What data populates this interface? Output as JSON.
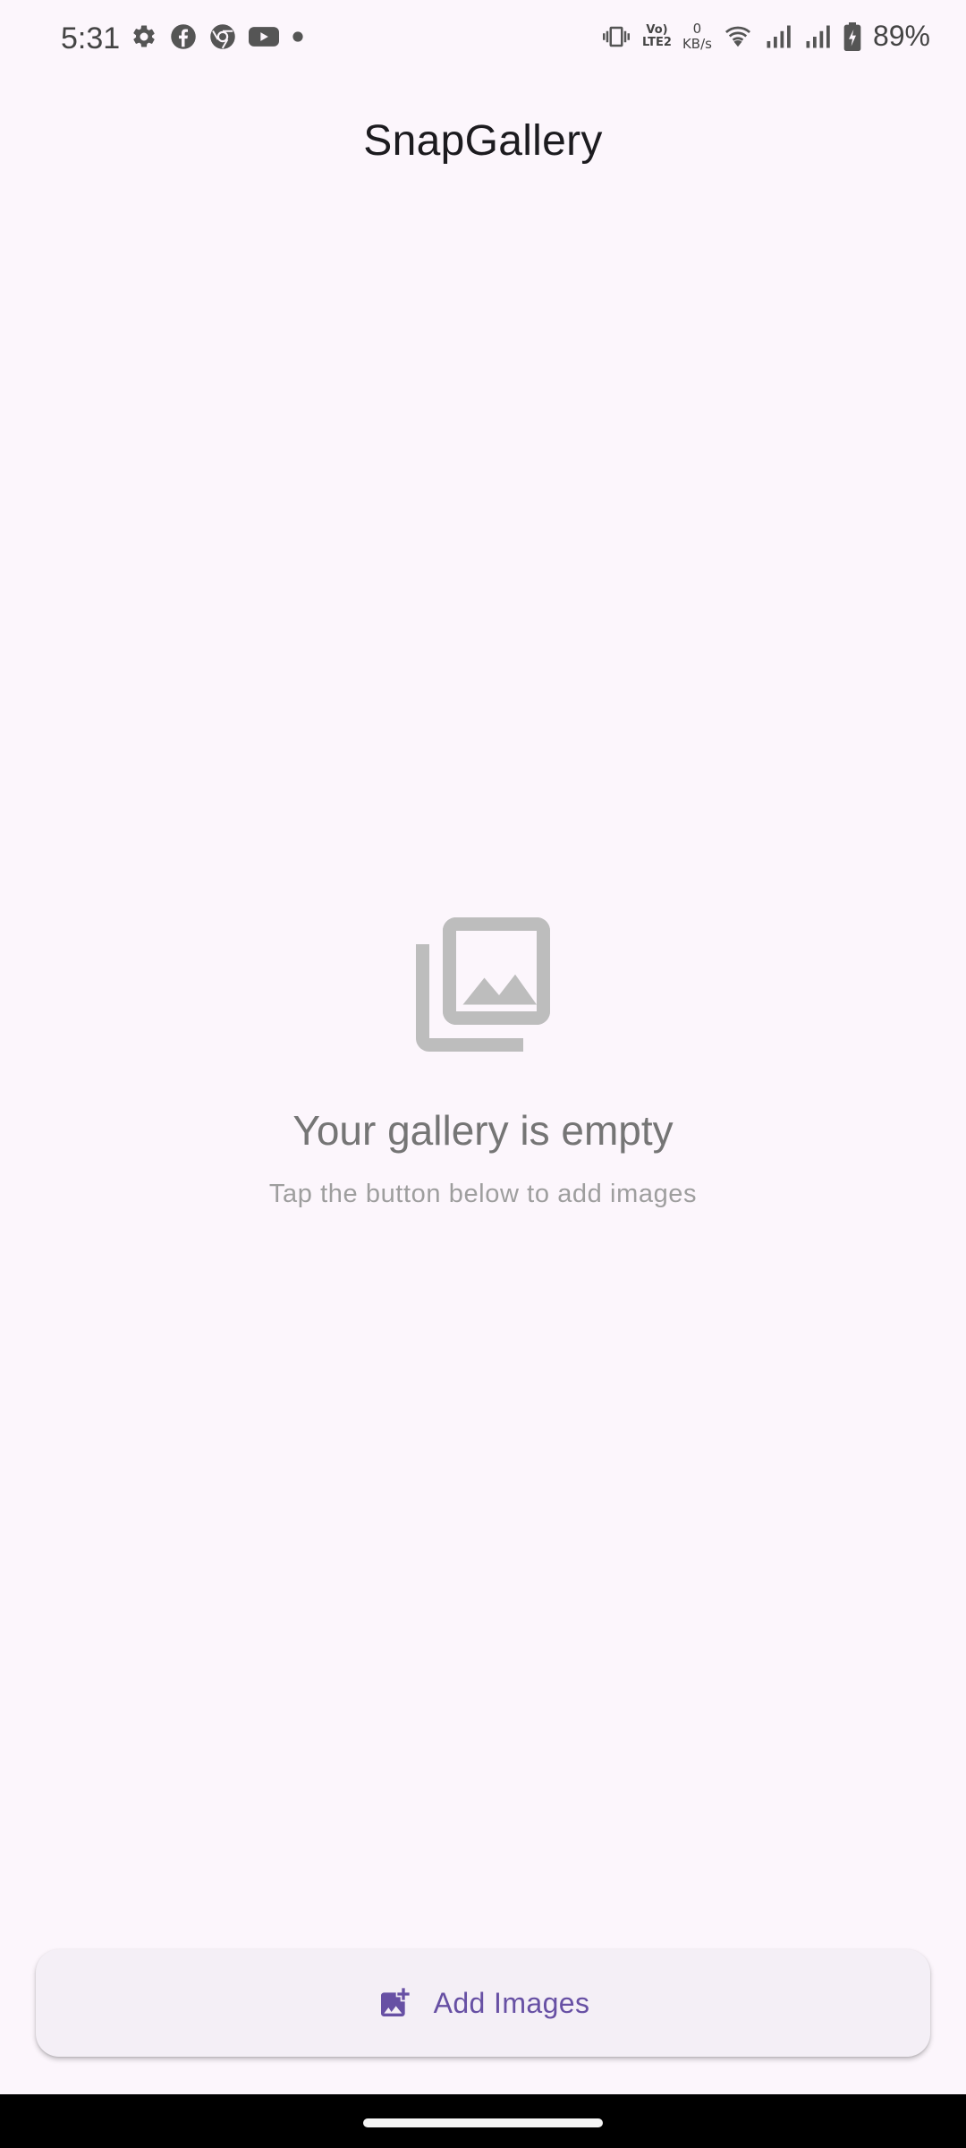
{
  "status_bar": {
    "time": "5:31",
    "left_icons": [
      "settings-icon",
      "facebook-icon",
      "chrome-icon",
      "youtube-icon",
      "dot-icon"
    ],
    "volte_line1": "Vo)",
    "volte_line2": "LTE2",
    "netspeed_value": "0",
    "netspeed_unit": "KB/s",
    "battery_percent": "89%"
  },
  "app_bar": {
    "title": "SnapGallery"
  },
  "empty_state": {
    "icon": "photo-library-icon",
    "title": "Your gallery is empty",
    "subtitle": "Tap the button below to add images"
  },
  "add_button": {
    "icon": "add-photo-icon",
    "label": "Add Images"
  },
  "colors": {
    "background": "#fcf6fc",
    "accent": "#6750a4",
    "button_bg": "#f4eff6",
    "empty_icon": "#bdbdbd",
    "empty_title": "#757575",
    "empty_subtitle": "#9e9e9e"
  }
}
